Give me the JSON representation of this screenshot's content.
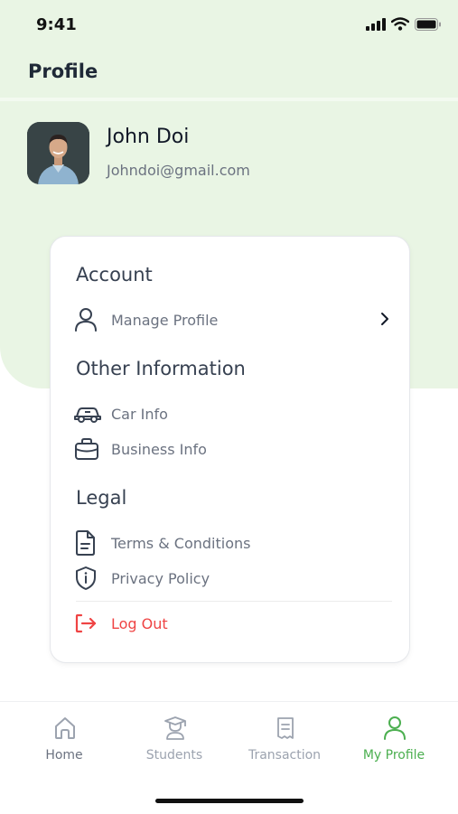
{
  "status_bar": {
    "time": "9:41"
  },
  "header": {
    "title": "Profile"
  },
  "user": {
    "name": "John Doi",
    "email": "Johndoi@gmail.com"
  },
  "sections": {
    "account": {
      "title": "Account",
      "items": [
        {
          "label": "Manage Profile",
          "icon": "user-icon"
        }
      ]
    },
    "other_information": {
      "title": "Other Information",
      "items": [
        {
          "label": "Car Info",
          "icon": "car-icon"
        },
        {
          "label": "Business Info",
          "icon": "briefcase-icon"
        }
      ]
    },
    "legal": {
      "title": "Legal",
      "items": [
        {
          "label": "Terms & Conditions",
          "icon": "document-icon"
        },
        {
          "label": "Privacy Policy",
          "icon": "shield-icon"
        }
      ]
    }
  },
  "logout": {
    "label": "Log Out",
    "icon": "logout-icon"
  },
  "tabs": [
    {
      "label": "Home",
      "icon": "home-icon",
      "active": false
    },
    {
      "label": "Students",
      "icon": "graduate-icon",
      "active": false
    },
    {
      "label": "Transaction",
      "icon": "receipt-icon",
      "active": false
    },
    {
      "label": "My Profile",
      "icon": "user-icon",
      "active": true
    }
  ],
  "colors": {
    "accent": "#4caf50",
    "hero_background": "#e9f5e4",
    "logout": "#ef4444",
    "muted_text": "#6b7280"
  }
}
